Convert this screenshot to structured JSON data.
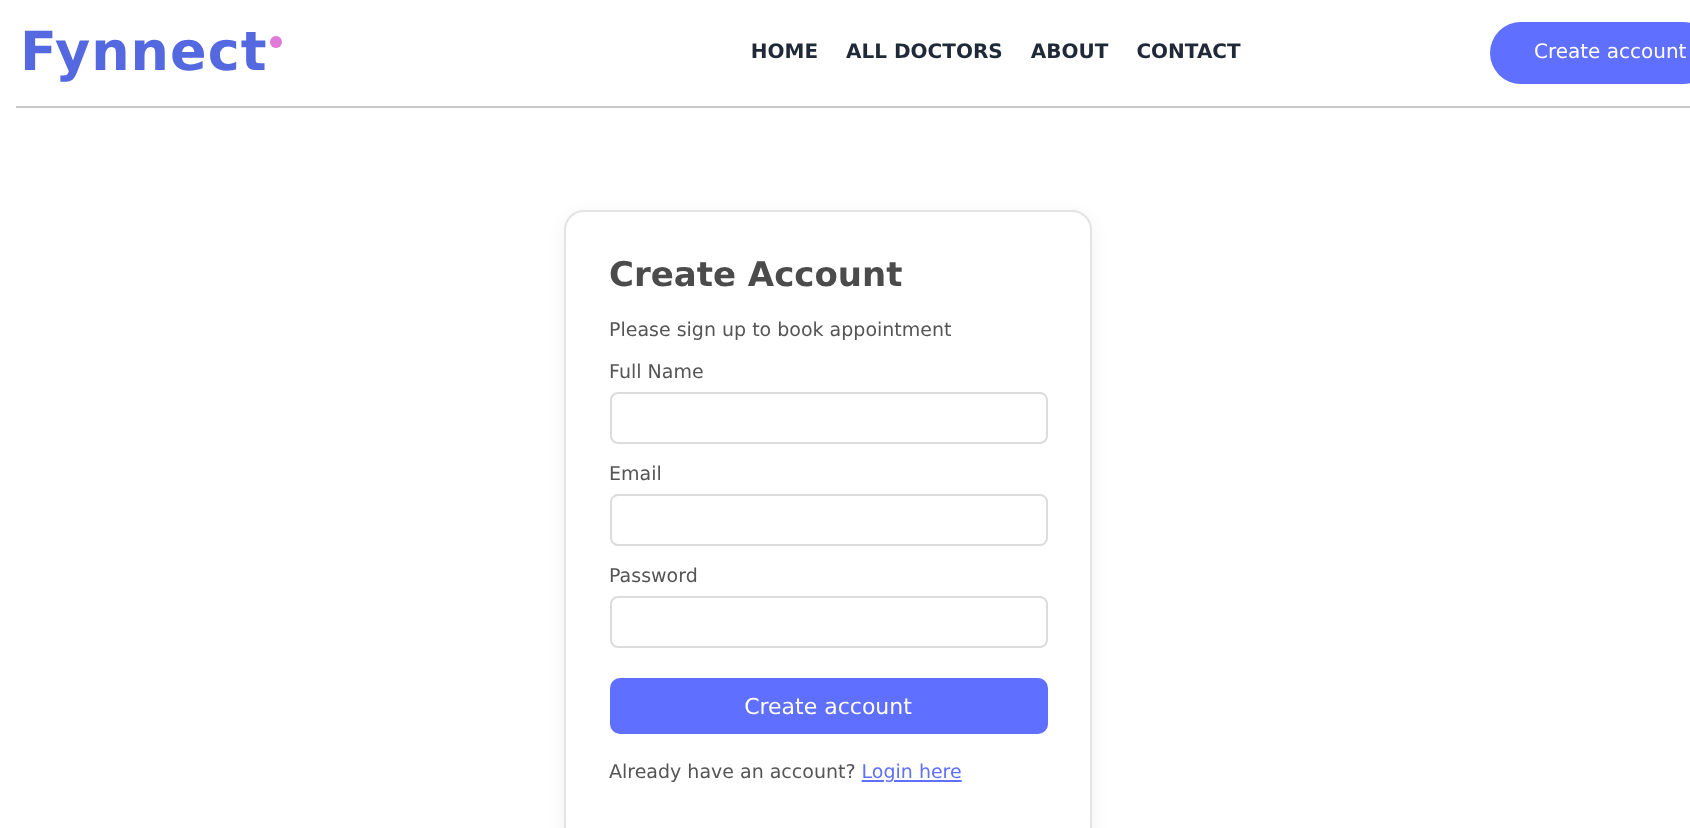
{
  "header": {
    "logo": "Fynnect",
    "nav": [
      {
        "label": "HOME"
      },
      {
        "label": "ALL DOCTORS"
      },
      {
        "label": "ABOUT"
      },
      {
        "label": "CONTACT"
      }
    ],
    "button": "Create account"
  },
  "form": {
    "title": "Create Account",
    "subtitle": "Please sign up to book appointment",
    "fields": [
      {
        "label": "Full Name"
      },
      {
        "label": "Email"
      },
      {
        "label": "Password"
      }
    ],
    "submit": "Create account",
    "footer_text": "Already have an account?",
    "footer_link": "Login here"
  }
}
